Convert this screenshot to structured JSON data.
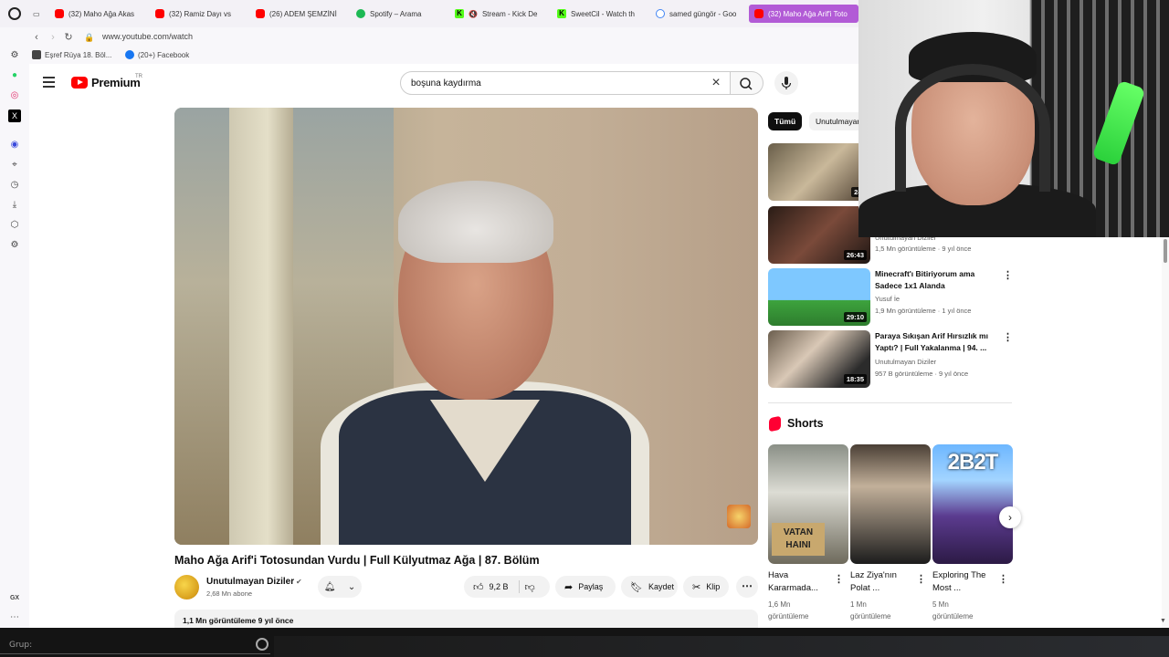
{
  "browser": {
    "tabs": [
      {
        "label": "(32) Maho Ağa Akas",
        "favicon": "youtube-icon"
      },
      {
        "label": "(32) Ramiz Dayı vs ",
        "favicon": "youtube-icon"
      },
      {
        "label": "(26) ADEM ŞEMZİNİ",
        "favicon": "youtube-icon"
      },
      {
        "label": "Spotify – Arama",
        "favicon": "spotify-icon"
      },
      {
        "label": "Stream - Kick De",
        "favicon": "kick-icon"
      },
      {
        "label": "SweetCil - Watch th",
        "favicon": "kick-icon"
      },
      {
        "label": "samed güngör - Goo",
        "favicon": "google-icon"
      },
      {
        "label": "(32) Maho Ağa Arif'i Toto",
        "favicon": "youtube-icon"
      }
    ],
    "url": "www.youtube.com/watch",
    "bookmarks": [
      {
        "label": "Eşref Rüya 18. Böl..."
      },
      {
        "label": "(20+) Facebook"
      }
    ]
  },
  "youtube": {
    "logo_text": "Premium",
    "country_code": "TR",
    "search_value": "boşuna kaydırma"
  },
  "video": {
    "title": "Maho Ağa Arif'i Totosundan Vurdu | Full Külyutmaz Ağa | 87. Bölüm",
    "channel": "Unutulmayan Diziler",
    "subscribers": "2,68 Mn abone",
    "likes": "9,2 B",
    "share_label": "Paylaş",
    "save_label": "Kaydet",
    "clip_label": "Klip",
    "stats": "1,1 Mn görüntüleme  9 yıl önce"
  },
  "chips": {
    "all": "Tümü",
    "channel": "Unutulmayan"
  },
  "recommendations": [
    {
      "title": "",
      "channel": "",
      "meta": "",
      "duration": "24:"
    },
    {
      "title": "",
      "channel": "Unutulmayan Diziler",
      "meta": "1,5 Mn görüntüleme · 9 yıl önce",
      "duration": "26:43"
    },
    {
      "title": "Minecraft'ı Bitiriyorum ama Sadece 1x1 Alanda",
      "channel": "Yusuf İe",
      "meta": "1,9 Mn görüntüleme · 1 yıl önce",
      "duration": "29:10"
    },
    {
      "title": "Paraya Sıkışan Arif Hırsızlık mı Yaptı? | Full Yakalanma | 94. ...",
      "channel": "Unutulmayan Diziler",
      "meta": "957 B görüntüleme · 9 yıl önce",
      "duration": "18:35"
    }
  ],
  "shorts": {
    "label": "Shorts",
    "items": [
      {
        "title": "Hava Kararmada...",
        "views": "1,6 Mn görüntüleme",
        "thumb_text": "VATAN HAINI"
      },
      {
        "title": "Laz Ziya'nın Polat ...",
        "views": "1 Mn görüntüleme",
        "thumb_text": ""
      },
      {
        "title": "Exploring The Most ...",
        "views": "5 Mn görüntüleme",
        "thumb_text": "2B2T"
      }
    ]
  },
  "taskbar": {
    "group_label": "Grup:"
  },
  "colors": {
    "youtube_red": "#ff0000",
    "active_tab": "#b25bd6",
    "taskbar": "#141414"
  }
}
